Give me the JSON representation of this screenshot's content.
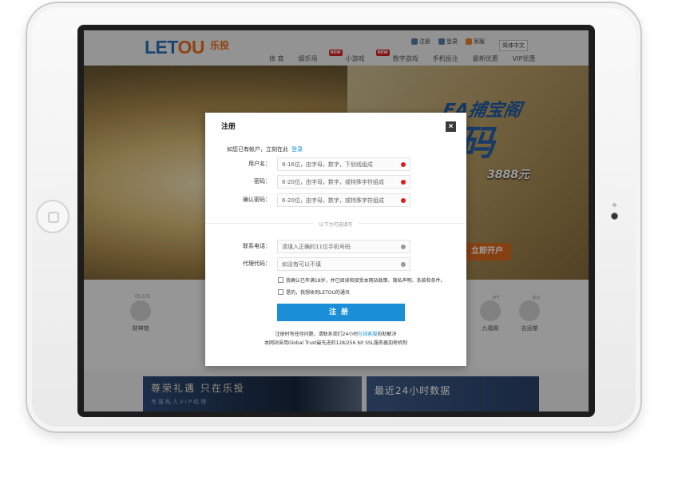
{
  "header": {
    "logo_latin_a": "LET",
    "logo_latin_b": "OU",
    "logo_cn": "乐投",
    "toplinks": [
      "注册",
      "登录",
      "客服"
    ],
    "language": "简体中文",
    "nav": [
      "体 育",
      "娱乐场",
      "小游戏",
      "数字游戏",
      "手机投注",
      "最新优惠",
      "VIP优惠"
    ],
    "nav_badge": "NEW"
  },
  "banner": {
    "title": "EA捕宝阁",
    "big": "码",
    "amount": "3888元",
    "cta": "立即开户"
  },
  "products": {
    "left_item": "财神馆",
    "left_tag": "OLUS",
    "right_items": [
      "九福阁",
      "吉运楼"
    ],
    "right_tags": [
      "PT",
      "EV"
    ]
  },
  "promos": {
    "vip_title": "尊荣礼遇 只在乐投",
    "vip_sub": "专属私人VIP经理",
    "data_title": "最近24小时数据"
  },
  "modal": {
    "title": "注册",
    "close": "×",
    "login_prompt": "如您已有帐户，立刻在此",
    "login_link": "登录",
    "fields": [
      {
        "label": "用户名：",
        "placeholder": "8-16位，由字母，数字，下划线组成"
      },
      {
        "label": "密码：",
        "placeholder": "6-20位，由字母，数字，或特殊字符组成"
      },
      {
        "label": "确认密码：",
        "placeholder": "6-20位，由字母，数字，或特殊字符组成"
      }
    ],
    "optional_label": "以下为可选填写",
    "optional_fields": [
      {
        "label": "联系电话：",
        "placeholder": "请填入正确的11位手机号码"
      },
      {
        "label": "代理代码：",
        "placeholder": "如没有可以不填"
      }
    ],
    "checkbox_terms": "我确认已年满18岁，并已阅读和接受本网站政策、隐私声明、条款和条件。",
    "checkbox_news": "是的，我想收到LETOU的通讯",
    "submit": "注册",
    "help_prefix": "注册时有任何问题，请联系我们24小时",
    "help_link": "在线客服",
    "help_suffix": "协助解决",
    "ssl_note": "本网站采用Global Trust最先进的128/256 bit SSL服务器加密机制"
  },
  "colors": {
    "accent_blue": "#1a8fd8",
    "required_dot": "#e01b1b",
    "logo_blue": "#2a6fb8",
    "logo_orange": "#e96b1c"
  }
}
